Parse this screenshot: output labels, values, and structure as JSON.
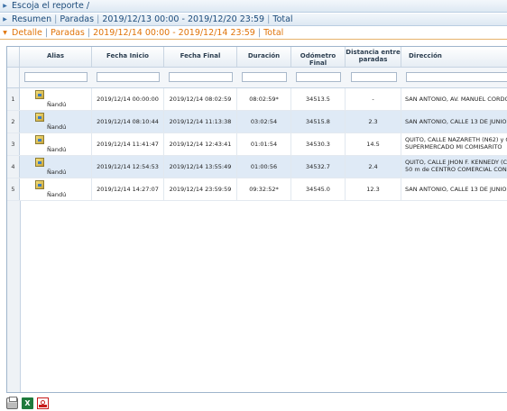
{
  "accordion": {
    "report": {
      "label": "Escoja el reporte /"
    },
    "summary": {
      "title": "Resumen",
      "type": "Paradas",
      "range": "2019/12/13 00:00 - 2019/12/20 23:59",
      "total": "Total"
    },
    "detail": {
      "title": "Detalle",
      "type": "Paradas",
      "range": "2019/12/14 00:00 - 2019/12/14 23:59",
      "total": "Total"
    }
  },
  "table": {
    "headers": {
      "alias": "Alias",
      "start": "Fecha Inicio",
      "end": "Fecha Final",
      "duration": "Duración",
      "odometer": "Odómetro Final",
      "distance_1": "Distancia entre",
      "distance_2": "paradas",
      "address": "Dirección"
    },
    "rows": [
      {
        "n": "1",
        "alias": "Ñandú",
        "start": "2019/12/14 00:00:00",
        "end": "2019/12/14 08:02:59",
        "duration": "08:02:59*",
        "odometer": "34513.5",
        "distance": "-",
        "address_1": "SAN ANTONIO, AV. MANUEL CORDO",
        "address_2": ""
      },
      {
        "n": "2",
        "alias": "Ñandú",
        "start": "2019/12/14 08:10:44",
        "end": "2019/12/14 11:13:38",
        "duration": "03:02:54",
        "odometer": "34515.8",
        "distance": "2.3",
        "address_1": "SAN ANTONIO, CALLE 13 DE JUNIO",
        "address_2": ""
      },
      {
        "n": "3",
        "alias": "Ñandú",
        "start": "2019/12/14 11:41:47",
        "end": "2019/12/14 12:43:41",
        "duration": "01:01:54",
        "odometer": "34530.3",
        "distance": "14.5",
        "address_1": "QUITO, CALLE NAZARETH (N62) y C",
        "address_2": "SUPERMERCADO MI COMISARITO"
      },
      {
        "n": "4",
        "alias": "Ñandú",
        "start": "2019/12/14 12:54:53",
        "end": "2019/12/14 13:55:49",
        "duration": "01:00:56",
        "odometer": "34532.7",
        "distance": "2.4",
        "address_1": "QUITO, CALLE JHON F. KENNEDY (C",
        "address_2": "50 m de CENTRO COMERCIAL COND"
      },
      {
        "n": "5",
        "alias": "Ñandú",
        "start": "2019/12/14 14:27:07",
        "end": "2019/12/14 23:59:59",
        "duration": "09:32:52*",
        "odometer": "34545.0",
        "distance": "12.3",
        "address_1": "SAN ANTONIO, CALLE 13 DE JUNIO",
        "address_2": ""
      }
    ]
  },
  "footer": {
    "icons": [
      "print-icon",
      "excel-icon",
      "pdf-icon"
    ],
    "excel_glyph": "X"
  },
  "colors": {
    "active_header": "#e0740a",
    "header_text": "#1c4b7a",
    "row_alt": "#dfeaf6"
  }
}
